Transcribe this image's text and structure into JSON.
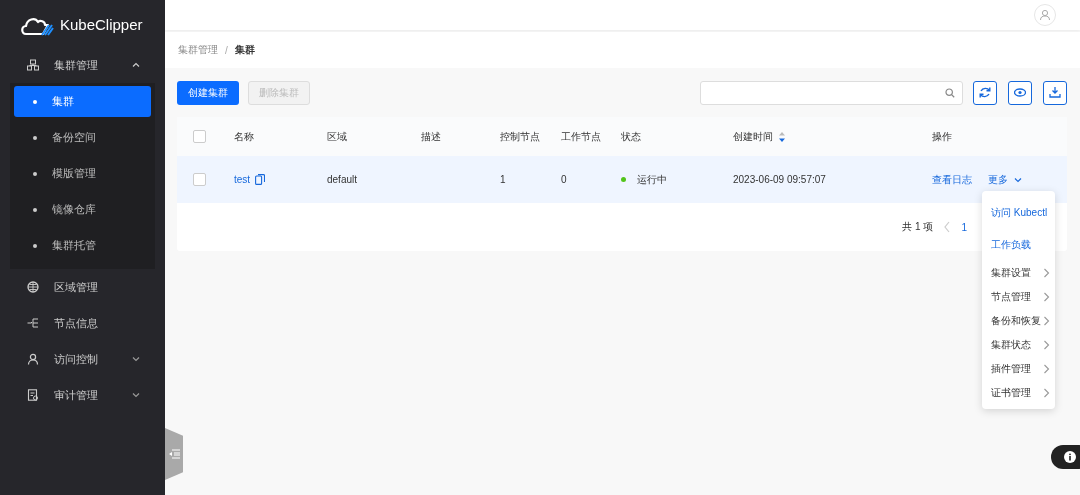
{
  "sidebar": {
    "logo": "KubeClipper",
    "items": [
      {
        "label": "集群管理",
        "expanded": true,
        "children": [
          {
            "label": "集群",
            "selected": true
          },
          {
            "label": "备份空间",
            "selected": false
          },
          {
            "label": "模版管理",
            "selected": false
          },
          {
            "label": "镜像仓库",
            "selected": false
          },
          {
            "label": "集群托管",
            "selected": false
          }
        ]
      },
      {
        "label": "区域管理"
      },
      {
        "label": "节点信息"
      },
      {
        "label": "访问控制",
        "expanded": false
      },
      {
        "label": "审计管理",
        "expanded": false
      }
    ]
  },
  "breadcrumb": [
    {
      "label": "集群管理",
      "current": false
    },
    {
      "label": "集群",
      "current": true
    }
  ],
  "breadcrumb_separator": "/",
  "toolbar": {
    "buttons": [
      {
        "label": "创建集群",
        "disabled": false
      },
      {
        "label": "删除集群",
        "disabled": true
      }
    ]
  },
  "table": {
    "select_all_checked": false,
    "columns": [
      {
        "label": "名称"
      },
      {
        "label": "区域"
      },
      {
        "label": "描述"
      },
      {
        "label": "控制节点"
      },
      {
        "label": "工作节点"
      },
      {
        "label": "状态"
      },
      {
        "label": "创建时间",
        "sortable": true
      },
      {
        "label": "操作"
      }
    ],
    "rows": [
      {
        "checked": false,
        "name": "test",
        "region": "default",
        "control_nodes": "1",
        "worker_nodes": "0",
        "status": "运行中",
        "color": "#52c41a",
        "created": "2023-06-09 09:57:07",
        "actions": [
          "查看日志",
          "更多"
        ]
      }
    ]
  },
  "pagination": {
    "total": "共 1 项",
    "pages": [
      {
        "label": "1",
        "selected": true
      }
    ]
  },
  "dropdown": [
    {
      "label": "访问 Kubectl",
      "kind": "link"
    },
    {
      "label": "工作负载",
      "kind": "link"
    },
    {
      "label": "集群设置",
      "kind": "submenu"
    },
    {
      "label": "节点管理",
      "kind": "submenu"
    },
    {
      "label": "备份和恢复",
      "kind": "submenu"
    },
    {
      "label": "集群状态",
      "kind": "submenu"
    },
    {
      "label": "插件管理",
      "kind": "submenu"
    },
    {
      "label": "证书管理",
      "kind": "submenu"
    }
  ]
}
